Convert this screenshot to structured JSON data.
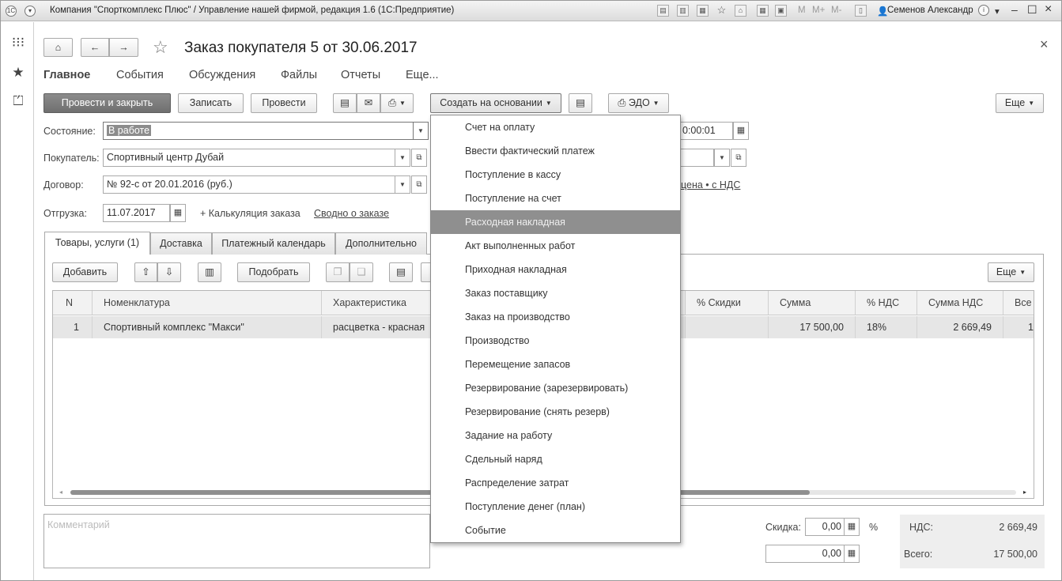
{
  "titlebar": {
    "title": "Компания \"Спорткомплекс Плюс\" / Управление нашей фирмой, редакция 1.6  (1С:Предприятие)",
    "memory_buttons": [
      "M",
      "M+",
      "M-"
    ],
    "user": "Семенов Александр",
    "info_label": "i"
  },
  "document": {
    "title": "Заказ покупателя 5 от 30.06.2017",
    "close": "×"
  },
  "nav": {
    "items": [
      "Главное",
      "События",
      "Обсуждения",
      "Файлы",
      "Отчеты",
      "Еще..."
    ]
  },
  "toolbar": {
    "post_close": "Провести и закрыть",
    "save": "Записать",
    "post": "Провести",
    "create_based": "Создать на основании",
    "edo": "ЭДО",
    "more": "Еще"
  },
  "form": {
    "status_label": "Состояние:",
    "status_value": "В работе",
    "time_value": "0:00:01",
    "buyer_label": "Покупатель:",
    "buyer_value": "Спортивный центр Дубай",
    "contract_label": "Договор:",
    "contract_value": "№ 92-с от 20.01.2016 (руб.)",
    "price_link": "цена • с НДС",
    "shipment_label": "Отгрузка:",
    "shipment_value": "11.07.2017",
    "calc_link": "+ Калькуляция заказа",
    "summary_link": "Сводно о заказе"
  },
  "tabs": [
    "Товары, услуги (1)",
    "Доставка",
    "Платежный календарь",
    "Дополнительно"
  ],
  "table_toolbar": {
    "add": "Добавить",
    "pick": "Подобрать",
    "more": "Еще"
  },
  "table": {
    "columns": [
      "N",
      "Номенклатура",
      "Характеристика",
      "% Скидки",
      "Сумма",
      "% НДС",
      "Сумма НДС",
      "Все"
    ],
    "rows": [
      {
        "n": "1",
        "item": "Спортивный комплекс \"Макси\"",
        "variant": "расцветка - красная",
        "discount": "",
        "sum": "17 500,00",
        "vat_rate": "18%",
        "vat_sum": "2 669,49",
        "total": "1"
      }
    ]
  },
  "dropdown_menu": {
    "items": [
      "Счет на оплату",
      "Ввести фактический платеж",
      "Поступление в кассу",
      "Поступление на счет",
      "Расходная накладная",
      "Акт выполненных работ",
      "Приходная накладная",
      "Заказ поставщику",
      "Заказ на производство",
      "Производство",
      "Перемещение запасов",
      "Резервирование (зарезервировать)",
      "Резервирование (снять резерв)",
      "Задание на работу",
      "Сдельный наряд",
      "Распределение затрат",
      "Поступление денег (план)",
      "Событие"
    ],
    "selected_index": 4
  },
  "footer": {
    "comment_placeholder": "Комментарий",
    "discount_label": "Скидка:",
    "discount_value": "0,00",
    "discount_unit": "%",
    "discount_amount": "0,00",
    "vat_label": "НДС:",
    "vat_value": "2 669,49",
    "total_label": "Всего:",
    "total_value": "17 500,00"
  }
}
